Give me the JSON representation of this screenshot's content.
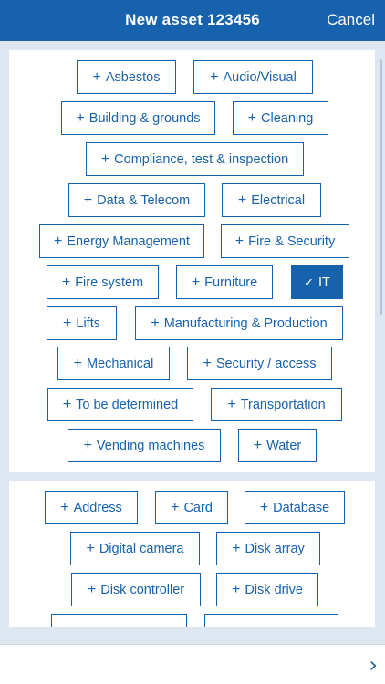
{
  "header": {
    "title": "New asset 123456",
    "cancel_label": "Cancel"
  },
  "icons": {
    "plus": "+",
    "check": "✓",
    "next": "›"
  },
  "categories": [
    {
      "label": "Asbestos",
      "selected": false
    },
    {
      "label": "Audio/Visual",
      "selected": false
    },
    {
      "label": "Building & grounds",
      "selected": false
    },
    {
      "label": "Cleaning",
      "selected": false
    },
    {
      "label": "Compliance, test & inspection",
      "selected": false
    },
    {
      "label": "Data & Telecom",
      "selected": false
    },
    {
      "label": "Electrical",
      "selected": false
    },
    {
      "label": "Energy Management",
      "selected": false
    },
    {
      "label": "Fire & Security",
      "selected": false
    },
    {
      "label": "Fire system",
      "selected": false
    },
    {
      "label": "Furniture",
      "selected": false
    },
    {
      "label": "IT",
      "selected": true
    },
    {
      "label": "Lifts",
      "selected": false
    },
    {
      "label": "Manufacturing & Production",
      "selected": false
    },
    {
      "label": "Mechanical",
      "selected": false
    },
    {
      "label": "Security / access",
      "selected": false
    },
    {
      "label": "To be determined",
      "selected": false
    },
    {
      "label": "Transportation",
      "selected": false
    },
    {
      "label": "Vending machines",
      "selected": false
    },
    {
      "label": "Water",
      "selected": false
    }
  ],
  "subcategories": [
    {
      "label": "Address"
    },
    {
      "label": "Card"
    },
    {
      "label": "Database"
    },
    {
      "label": "Digital camera"
    },
    {
      "label": "Disk array"
    },
    {
      "label": "Disk controller"
    },
    {
      "label": "Disk drive"
    },
    {
      "label": ""
    },
    {
      "label": ""
    }
  ]
}
